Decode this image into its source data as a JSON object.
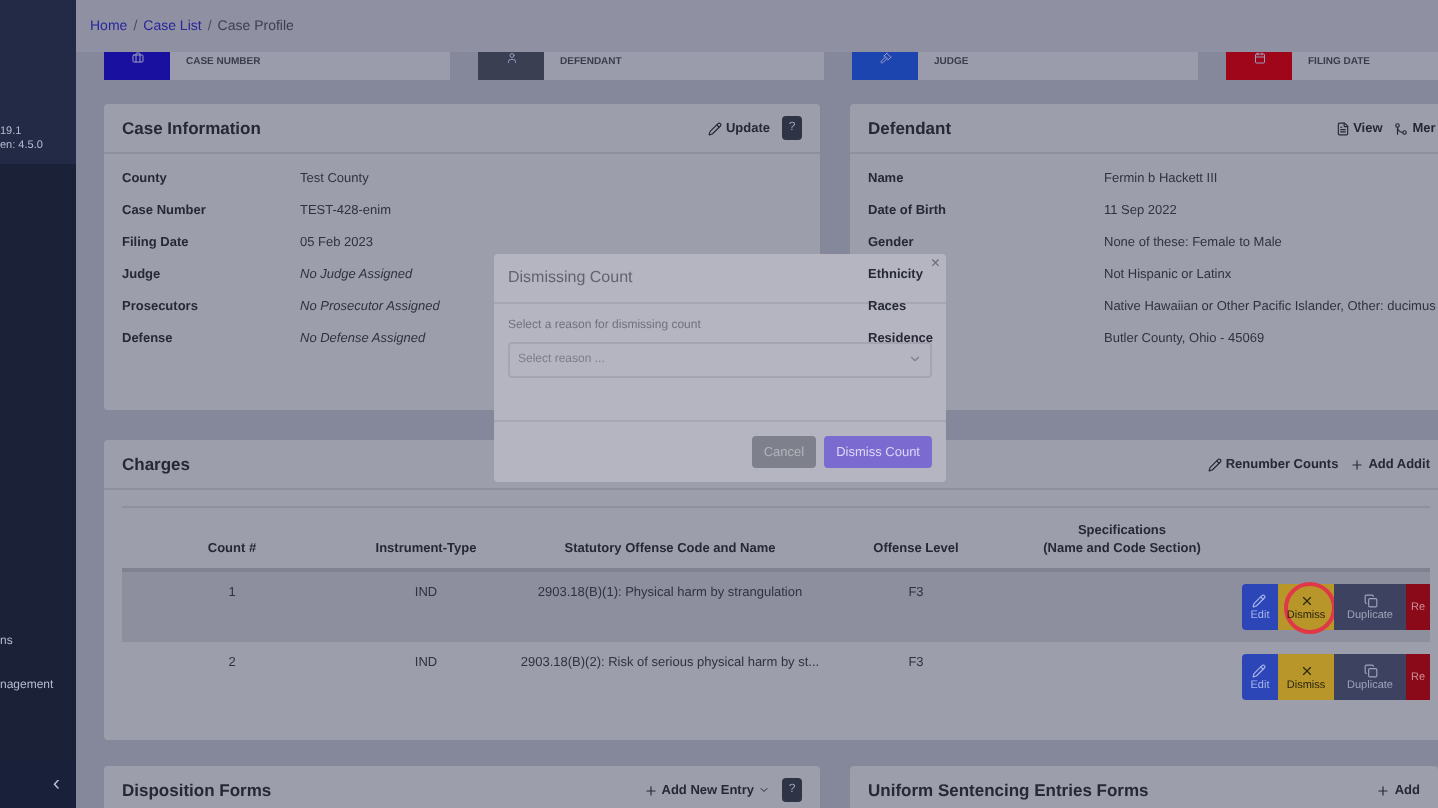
{
  "sidebar": {
    "version_lines": [
      "19.1",
      "en: 4.5.0"
    ],
    "items": [
      {
        "label": "ns"
      },
      {
        "label": "nagement"
      }
    ],
    "collapse": "‹"
  },
  "breadcrumb": {
    "separator": "/",
    "items": [
      {
        "label": "Home",
        "kind": "link"
      },
      {
        "label": "Case List",
        "kind": "link"
      },
      {
        "label": "Case Profile",
        "kind": "current"
      }
    ]
  },
  "stat_cards": [
    {
      "label": "CASE NUMBER",
      "color": "#1a10a0"
    },
    {
      "label": "DEFENDANT",
      "color": "#3a3f52"
    },
    {
      "label": "JUDGE",
      "color": "#1c45b0"
    },
    {
      "label": "FILING DATE",
      "color": "#a0061a"
    }
  ],
  "case_information": {
    "title": "Case Information",
    "actions": [
      {
        "label": "Update",
        "kind": "edit"
      },
      {
        "label": "?",
        "kind": "help"
      }
    ],
    "fields": [
      {
        "label": "County",
        "value": "Test County",
        "italic": false
      },
      {
        "label": "Case Number",
        "value": "TEST-428-enim",
        "italic": false
      },
      {
        "label": "Filing Date",
        "value": "05 Feb 2023",
        "italic": false
      },
      {
        "label": "Judge",
        "value": "No Judge Assigned",
        "italic": true
      },
      {
        "label": "Prosecutors",
        "value": "No Prosecutor Assigned",
        "italic": true
      },
      {
        "label": "Defense",
        "value": "No Defense Assigned",
        "italic": true
      }
    ]
  },
  "defendant": {
    "title": "Defendant",
    "actions": [
      {
        "label": "View",
        "kind": "view"
      },
      {
        "label": "Mer",
        "kind": "merge"
      }
    ],
    "fields": [
      {
        "label": "Name",
        "value": "Fermin b Hackett III"
      },
      {
        "label": "Date of Birth",
        "value": "11 Sep 2022"
      },
      {
        "label": "Gender",
        "value": "None of these: Female to Male"
      },
      {
        "label": "Ethnicity",
        "value": "Not Hispanic or Latinx"
      },
      {
        "label": "Races",
        "value": "Native Hawaiian or Other Pacific Islander, Other: ducimus"
      },
      {
        "label": "Residence",
        "value": "Butler County, Ohio - 45069"
      }
    ]
  },
  "charges": {
    "title": "Charges",
    "actions": [
      {
        "label": "Renumber Counts",
        "kind": "edit"
      },
      {
        "label": "Add Addit",
        "kind": "add"
      }
    ],
    "columns": [
      "Count #",
      "Instrument-Type",
      "Statutory Offense Code and Name",
      "Offense Level",
      "Specifications\n(Name and Code Section)"
    ],
    "rows": [
      {
        "count": "1",
        "instrument": "IND",
        "offense": "2903.18(B)(1): Physical harm by strangulation",
        "level": "F3",
        "selected": true,
        "buttons": [
          {
            "label": "Edit",
            "kind": "edit"
          },
          {
            "label": "Dismiss",
            "kind": "dismiss"
          },
          {
            "label": "Duplicate",
            "kind": "duplicate"
          },
          {
            "label": "Re",
            "kind": "remove"
          }
        ]
      },
      {
        "count": "2",
        "instrument": "IND",
        "offense": "2903.18(B)(2): Risk of serious physical harm by st...",
        "level": "F3",
        "selected": false,
        "buttons": [
          {
            "label": "Edit",
            "kind": "edit"
          },
          {
            "label": "Dismiss",
            "kind": "dismiss"
          },
          {
            "label": "Duplicate",
            "kind": "duplicate"
          },
          {
            "label": "Re",
            "kind": "remove"
          }
        ]
      }
    ]
  },
  "bottom_panels": [
    {
      "title": "Disposition Forms",
      "actions": [
        {
          "label": "Add New Entry",
          "kind": "add-menu"
        },
        {
          "label": "?",
          "kind": "help"
        }
      ]
    },
    {
      "title": "Uniform Sentencing Entries Forms",
      "actions": [
        {
          "label": "Add",
          "kind": "add"
        }
      ]
    }
  ],
  "modal": {
    "title": "Dismissing Count",
    "close": "×",
    "prompt": "Select a reason for dismissing count",
    "select": {
      "placeholder": "Select reason ..."
    },
    "buttons": [
      {
        "label": "Cancel",
        "kind": "secondary"
      },
      {
        "label": "Dismiss Count",
        "kind": "primary"
      }
    ]
  }
}
